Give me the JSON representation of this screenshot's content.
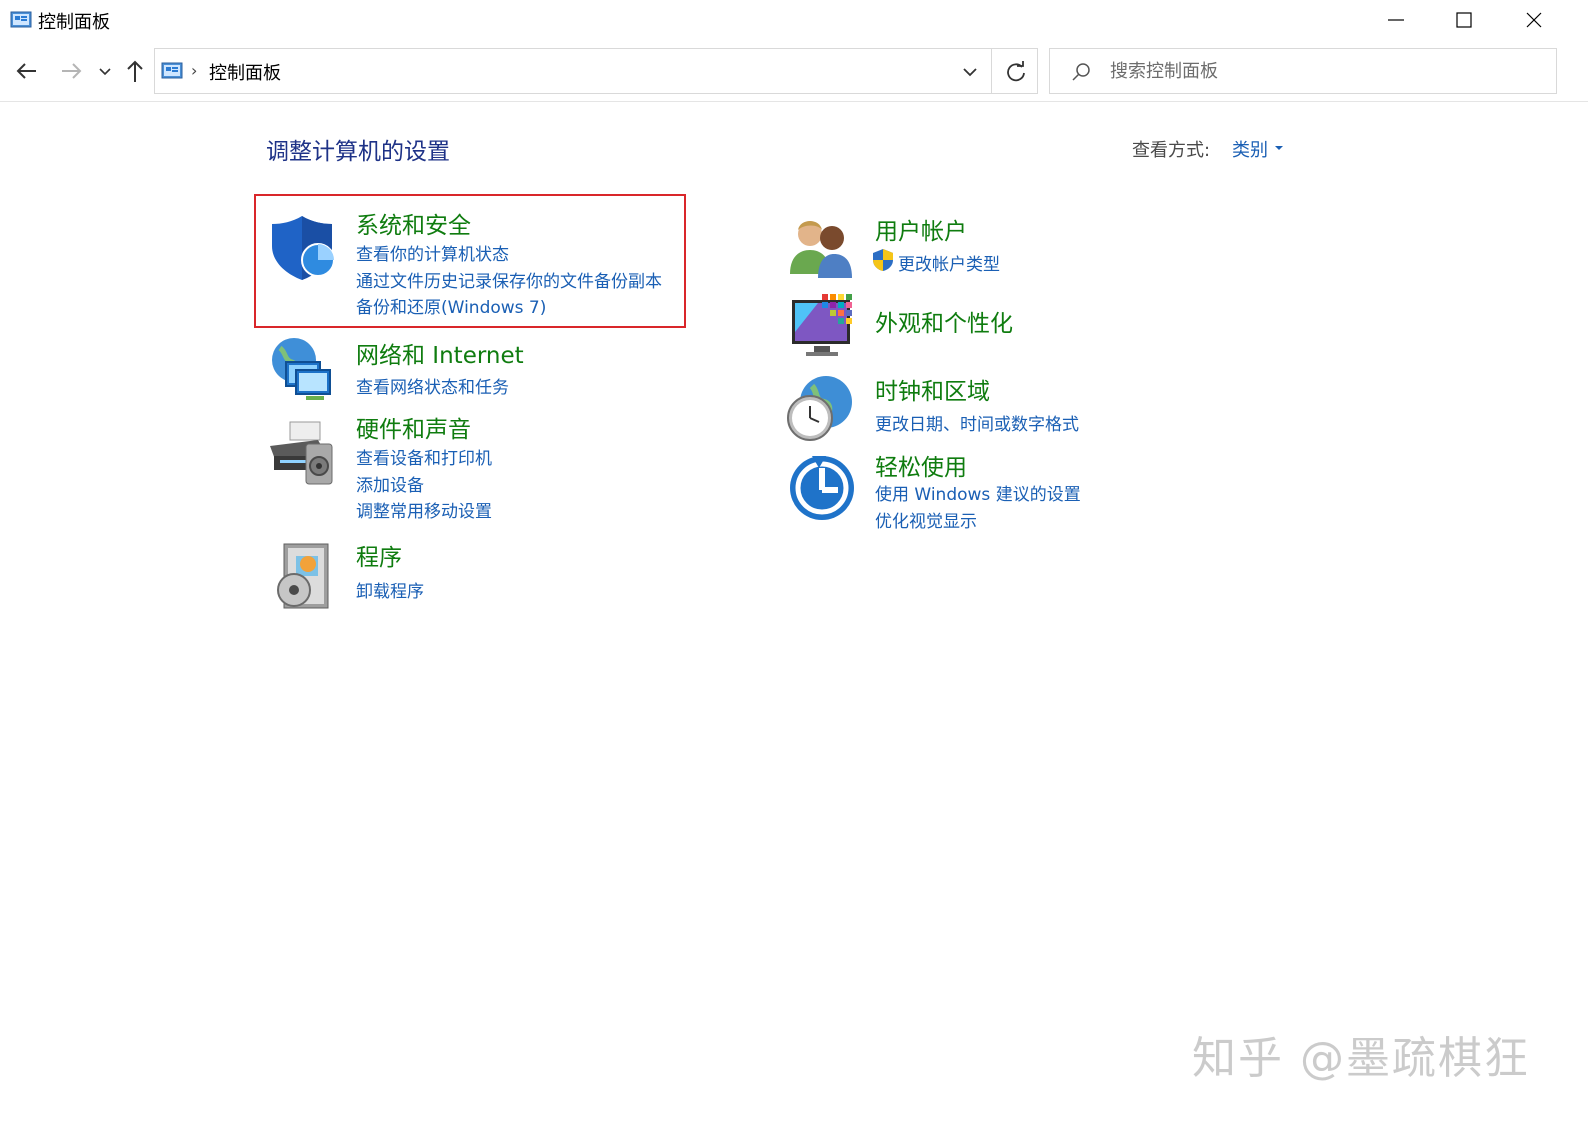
{
  "window": {
    "title": "控制面板",
    "controls": {
      "minimize": "minimize",
      "maximize": "maximize",
      "close": "close"
    }
  },
  "navigation": {
    "breadcrumb": [
      "控制面板"
    ],
    "search_placeholder": "搜索控制面板"
  },
  "main": {
    "heading": "调整计算机的设置",
    "view_by_label": "查看方式:",
    "view_by_value": "类别"
  },
  "categories_left": [
    {
      "title": "系统和安全",
      "icon": "shield-icon",
      "links": [
        "查看你的计算机状态",
        "通过文件历史记录保存你的文件备份副本",
        "备份和还原(Windows 7)"
      ],
      "highlighted": true
    },
    {
      "title": "网络和 Internet",
      "icon": "network-globe-icon",
      "links": [
        "查看网络状态和任务"
      ]
    },
    {
      "title": "硬件和声音",
      "icon": "printer-speaker-icon",
      "links": [
        "查看设备和打印机",
        "添加设备",
        "调整常用移动设置"
      ]
    },
    {
      "title": "程序",
      "icon": "programs-disc-icon",
      "links": [
        "卸载程序"
      ]
    }
  ],
  "categories_right": [
    {
      "title": "用户帐户",
      "icon": "users-icon",
      "links": [
        "更改帐户类型"
      ],
      "link_icon": "uac-shield-icon"
    },
    {
      "title": "外观和个性化",
      "icon": "monitor-palette-icon",
      "links": []
    },
    {
      "title": "时钟和区域",
      "icon": "clock-globe-icon",
      "links": [
        "更改日期、时间或数字格式"
      ]
    },
    {
      "title": "轻松使用",
      "icon": "ease-of-access-icon",
      "links": [
        "使用 Windows 建议的设置",
        "优化视觉显示"
      ]
    }
  ],
  "watermark": "知乎 @墨疏棋狂",
  "colors": {
    "category_title": "#0f7c0f",
    "link": "#1a5fb4",
    "heading": "#1e3287",
    "highlight_border": "#d9262a"
  }
}
